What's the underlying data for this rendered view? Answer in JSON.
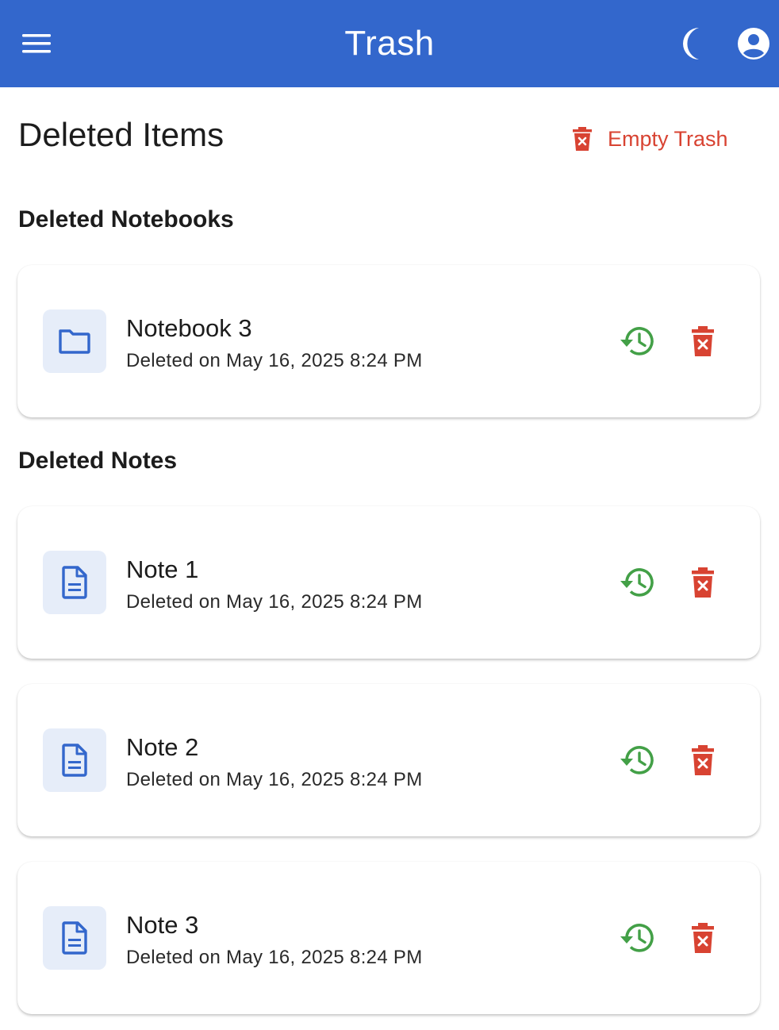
{
  "appbar": {
    "title": "Trash",
    "icons": {
      "menu": "menu-icon",
      "theme": "dark-mode-moon-icon",
      "account": "account-circle-icon"
    }
  },
  "page": {
    "title": "Deleted Items",
    "empty_trash_label": "Empty Trash"
  },
  "notebooks": {
    "heading": "Deleted Notebooks",
    "items": [
      {
        "name": "Notebook 3",
        "deleted": "Deleted on May 16, 2025 8:24 PM",
        "icon": "folder-icon"
      }
    ]
  },
  "notes": {
    "heading": "Deleted Notes",
    "items": [
      {
        "name": "Note 1",
        "deleted": "Deleted on May 16, 2025 8:24 PM",
        "icon": "document-icon"
      },
      {
        "name": "Note 2",
        "deleted": "Deleted on May 16, 2025 8:24 PM",
        "icon": "document-icon"
      },
      {
        "name": "Note 3",
        "deleted": "Deleted on May 16, 2025 8:24 PM",
        "icon": "document-icon"
      }
    ]
  },
  "colors": {
    "primary": "#3367cc",
    "danger": "#d84332",
    "restore": "#43a047",
    "avatar_bg": "#e6edf9"
  }
}
